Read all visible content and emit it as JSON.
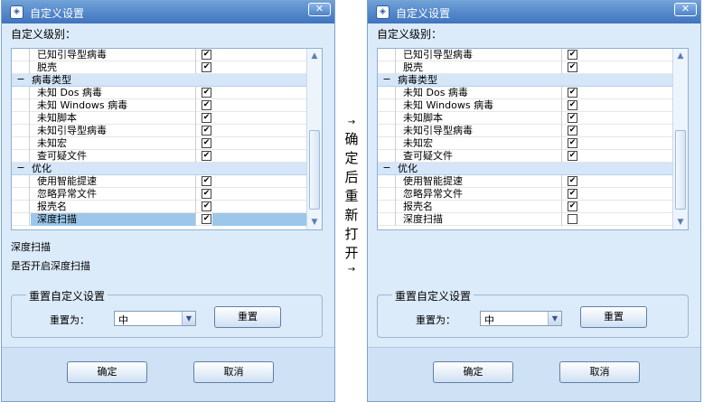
{
  "dialogs": [
    {
      "title": "自定义设置",
      "close_label": "✕",
      "level_label": "自定义级别：",
      "rows": [
        {
          "type": "item",
          "label": "已知引导型病毒",
          "checked": true,
          "selected": false
        },
        {
          "type": "item",
          "label": "脱壳",
          "checked": true,
          "selected": false
        },
        {
          "type": "group",
          "toggle": "−",
          "label": "病毒类型"
        },
        {
          "type": "item",
          "label": "未知 Dos 病毒",
          "checked": true,
          "selected": false
        },
        {
          "type": "item",
          "label": "未知 Windows 病毒",
          "checked": true,
          "selected": false
        },
        {
          "type": "item",
          "label": "未知脚本",
          "checked": true,
          "selected": false
        },
        {
          "type": "item",
          "label": "未知引导型病毒",
          "checked": true,
          "selected": false
        },
        {
          "type": "item",
          "label": "未知宏",
          "checked": true,
          "selected": false
        },
        {
          "type": "item",
          "label": "查可疑文件",
          "checked": true,
          "selected": false
        },
        {
          "type": "group",
          "toggle": "−",
          "label": "优化"
        },
        {
          "type": "item",
          "label": "使用智能提速",
          "checked": true,
          "selected": false
        },
        {
          "type": "item",
          "label": "忽略异常文件",
          "checked": true,
          "selected": false
        },
        {
          "type": "item",
          "label": "报壳名",
          "checked": true,
          "selected": false
        },
        {
          "type": "item",
          "label": "深度扫描",
          "checked": true,
          "selected": true
        }
      ],
      "description_title": "深度扫描",
      "description_text": "是否开启深度扫描",
      "reset_group_label": "重置自定义设置",
      "reset_to_label": "重置为：",
      "reset_select_value": "中",
      "reset_button": "重置",
      "ok_button": "确定",
      "cancel_button": "取消"
    },
    {
      "title": "自定义设置",
      "close_label": "✕",
      "level_label": "自定义级别：",
      "rows": [
        {
          "type": "item",
          "label": "已知引导型病毒",
          "checked": true,
          "selected": false
        },
        {
          "type": "item",
          "label": "脱壳",
          "checked": true,
          "selected": false
        },
        {
          "type": "group",
          "toggle": "−",
          "label": "病毒类型"
        },
        {
          "type": "item",
          "label": "未知 Dos 病毒",
          "checked": true,
          "selected": false
        },
        {
          "type": "item",
          "label": "未知 Windows 病毒",
          "checked": true,
          "selected": false
        },
        {
          "type": "item",
          "label": "未知脚本",
          "checked": true,
          "selected": false
        },
        {
          "type": "item",
          "label": "未知引导型病毒",
          "checked": true,
          "selected": false
        },
        {
          "type": "item",
          "label": "未知宏",
          "checked": true,
          "selected": false
        },
        {
          "type": "item",
          "label": "查可疑文件",
          "checked": true,
          "selected": false
        },
        {
          "type": "group",
          "toggle": "−",
          "label": "优化"
        },
        {
          "type": "item",
          "label": "使用智能提速",
          "checked": true,
          "selected": false
        },
        {
          "type": "item",
          "label": "忽略异常文件",
          "checked": true,
          "selected": false
        },
        {
          "type": "item",
          "label": "报壳名",
          "checked": true,
          "selected": false
        },
        {
          "type": "item",
          "label": "深度扫描",
          "checked": false,
          "selected": false
        }
      ],
      "reset_group_label": "重置自定义设置",
      "reset_to_label": "重置为：",
      "reset_select_value": "中",
      "reset_button": "重置",
      "ok_button": "确定",
      "cancel_button": "取消"
    }
  ],
  "middle": {
    "arrow_top": "→",
    "chars": [
      "确",
      "定",
      "后",
      "重",
      "新",
      "打",
      "开"
    ],
    "arrow_bottom": "→"
  }
}
